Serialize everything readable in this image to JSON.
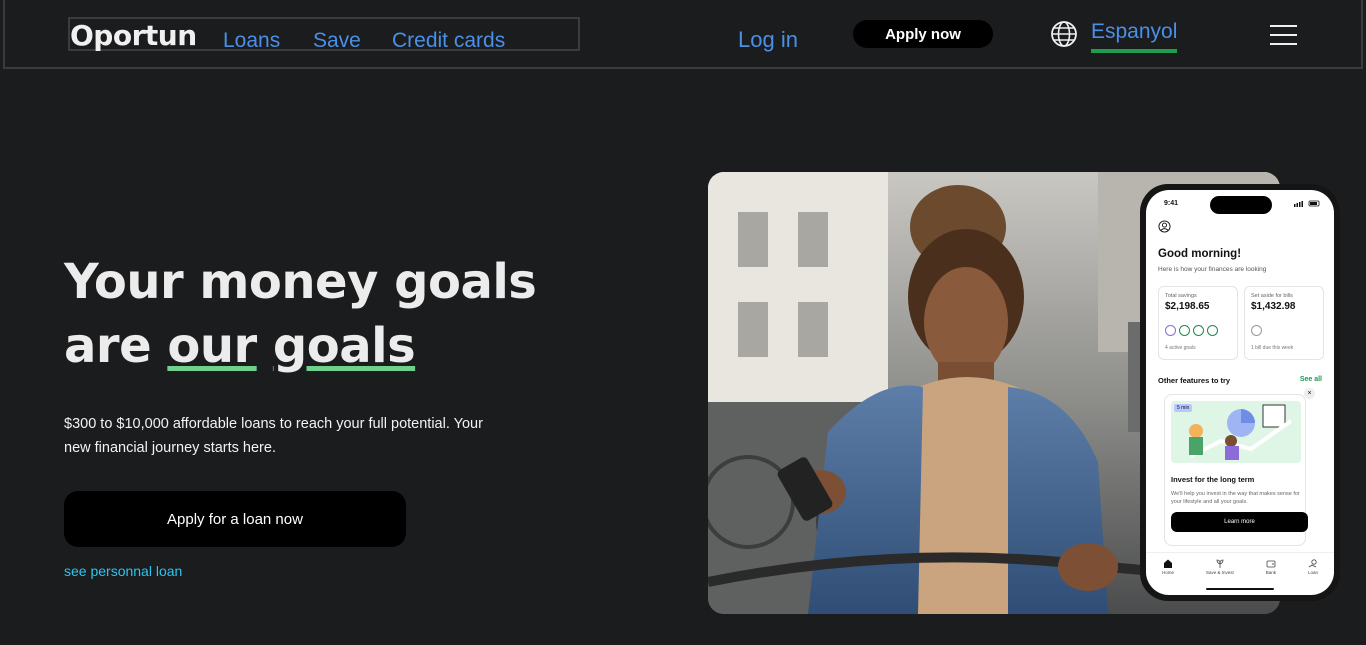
{
  "header": {
    "logo": "Oportun",
    "nav": [
      {
        "label": "Loans"
      },
      {
        "label": "Save"
      },
      {
        "label": "Credit cards"
      }
    ],
    "login_label": "Log in",
    "apply_label": "Apply now",
    "language_label": "Espanyol",
    "icons": [
      "globe-icon",
      "hamburger-menu-icon"
    ]
  },
  "hero": {
    "title_line1": "Your money goals",
    "title_are": "are",
    "title_our": "our",
    "title_goals": "goals",
    "subtitle": "$300 to $10,000 affordable loans to reach your full potential. Your new financial journey starts here.",
    "cta_label": "Apply for a loan now",
    "link_label": "see personnal loan"
  },
  "phone": {
    "time": "9:41",
    "greeting": "Good morning!",
    "greeting_sub": "Here is how your finances are looking",
    "cards": [
      {
        "label": "Total savings",
        "value": "$2,198.65",
        "foot": "4 active goals"
      },
      {
        "label": "Set aside for bills",
        "value": "$1,432.98",
        "foot": "1 bill due this week"
      }
    ],
    "features_title": "Other features to try",
    "see_all": "See all",
    "feature": {
      "time": "5 min",
      "title": "Invest for the long term",
      "desc": "We'll help you invest in the way that makes sense for your lifestyle and all your goals.",
      "button": "Learn more"
    },
    "tabs": [
      {
        "label": "Home"
      },
      {
        "label": "Save & Invest"
      },
      {
        "label": "Bank"
      },
      {
        "label": "Loan"
      }
    ]
  },
  "colors": {
    "background": "#1b1c1e",
    "link": "#4a8fe8",
    "accent_green": "#6fd08c",
    "link_cyan": "#2ec4f0"
  }
}
